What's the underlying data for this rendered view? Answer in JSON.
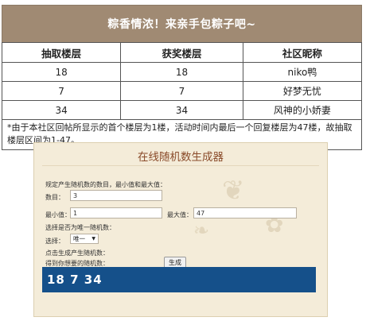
{
  "table": {
    "title": "粽香情浓！来亲手包粽子吧~",
    "headers": [
      "抽取楼层",
      "获奖楼层",
      "社区昵称"
    ],
    "rows": [
      [
        "18",
        "18",
        "niko鸭"
      ],
      [
        "7",
        "7",
        "好梦无忧"
      ],
      [
        "34",
        "34",
        "风神的小娇妻"
      ]
    ],
    "note": "*由于本社区回帖所显示的首个楼层为1楼，活动时间内最后一个回复楼层为47楼，故抽取楼层区间为1-47。"
  },
  "generator": {
    "title": "在线随机数生成器",
    "instruction": "规定产生随机数的数目，最小值和最大值：",
    "count_label": "数目：",
    "count_value": "3",
    "min_label": "最小值：",
    "min_value": "1",
    "max_label": "最大值：",
    "max_value": "47",
    "unique_question": "选择是否为唯一随机数：",
    "select_label": "选择：",
    "select_value": "唯一",
    "click_prompt": "点击生成产生随机数：",
    "generate_button": "生成",
    "result_label": "得到你想要的随机数：",
    "result_value": "18 7 34"
  }
}
